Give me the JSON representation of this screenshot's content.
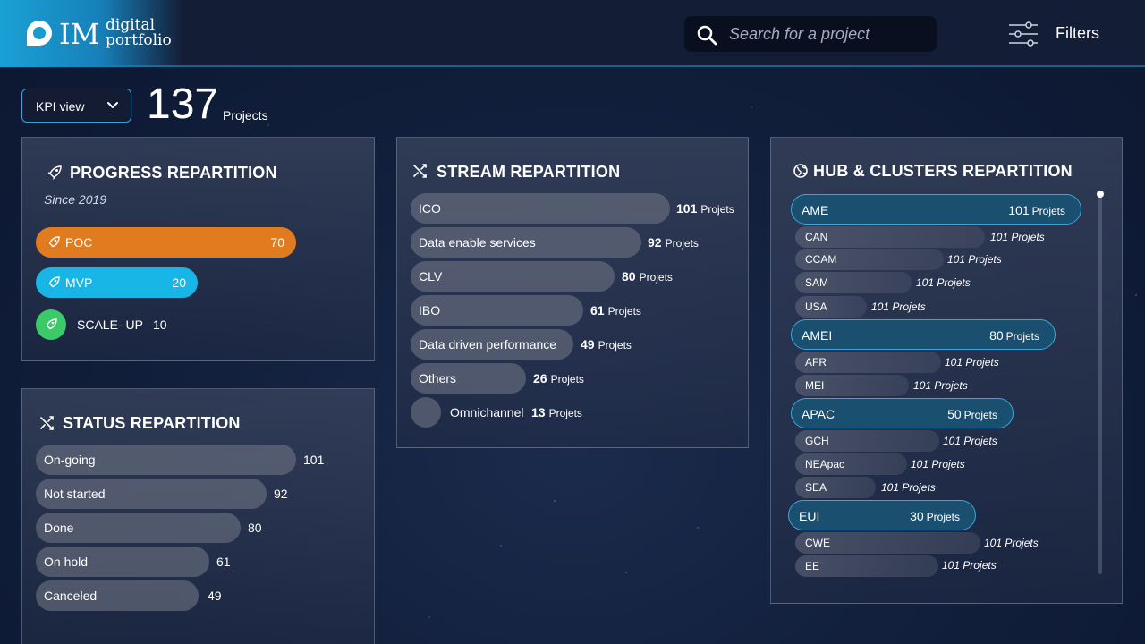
{
  "header": {
    "logo_mark": "IM",
    "logo_sub_1": "digital",
    "logo_sub_2": "portfolio",
    "search_placeholder": "Search for a project",
    "filters_label": "Filters"
  },
  "kpi": {
    "view_label": "KPI view",
    "total": "137",
    "total_label": "Projects"
  },
  "progress": {
    "title": "PROGRESS REPARTITION",
    "subtitle": "Since 2019",
    "items": [
      {
        "label": "POC",
        "value": "70",
        "color": "#e07b20"
      },
      {
        "label": "MVP",
        "value": "20",
        "color": "#17b6e6"
      },
      {
        "label": "SCALE- UP",
        "value": "10",
        "color": "#3cc96a"
      }
    ]
  },
  "status": {
    "title": "STATUS REPARTITION",
    "items": [
      {
        "label": "On-going",
        "value": "101"
      },
      {
        "label": "Not started",
        "value": "92"
      },
      {
        "label": "Done",
        "value": "80"
      },
      {
        "label": "On hold",
        "value": "61"
      },
      {
        "label": "Canceled",
        "value": "49"
      }
    ]
  },
  "stream": {
    "title": "STREAM REPARTITION",
    "unit": "Projets",
    "items": [
      {
        "label": "ICO",
        "value": "101"
      },
      {
        "label": "Data enable services",
        "value": "92"
      },
      {
        "label": "CLV",
        "value": "80"
      },
      {
        "label": "IBO",
        "value": "61"
      },
      {
        "label": "Data driven performance",
        "value": "49"
      },
      {
        "label": "Others",
        "value": "26"
      },
      {
        "label": "Omnichannel",
        "value": "13"
      }
    ]
  },
  "hub": {
    "title": "HUB & CLUSTERS REPARTITION",
    "unit": "Projets",
    "groups": [
      {
        "label": "AME",
        "value": "101",
        "subs": [
          {
            "label": "CAN",
            "value": "101 Projets"
          },
          {
            "label": "CCAM",
            "value": "101 Projets"
          },
          {
            "label": "SAM",
            "value": "101 Projets"
          },
          {
            "label": "USA",
            "value": "101 Projets"
          }
        ]
      },
      {
        "label": "AMEI",
        "value": "80",
        "subs": [
          {
            "label": "AFR",
            "value": "101 Projets"
          },
          {
            "label": "MEI",
            "value": "101 Projets"
          }
        ]
      },
      {
        "label": "APAC",
        "value": "50",
        "subs": [
          {
            "label": "GCH",
            "value": "101 Projets"
          },
          {
            "label": "NEApac",
            "value": "101 Projets"
          },
          {
            "label": "SEA",
            "value": "101 Projets"
          }
        ]
      },
      {
        "label": "EUI",
        "value": "30",
        "subs": [
          {
            "label": "CWE",
            "value": "101 Projets"
          },
          {
            "label": "EE",
            "value": "101 Projets"
          }
        ]
      }
    ]
  }
}
